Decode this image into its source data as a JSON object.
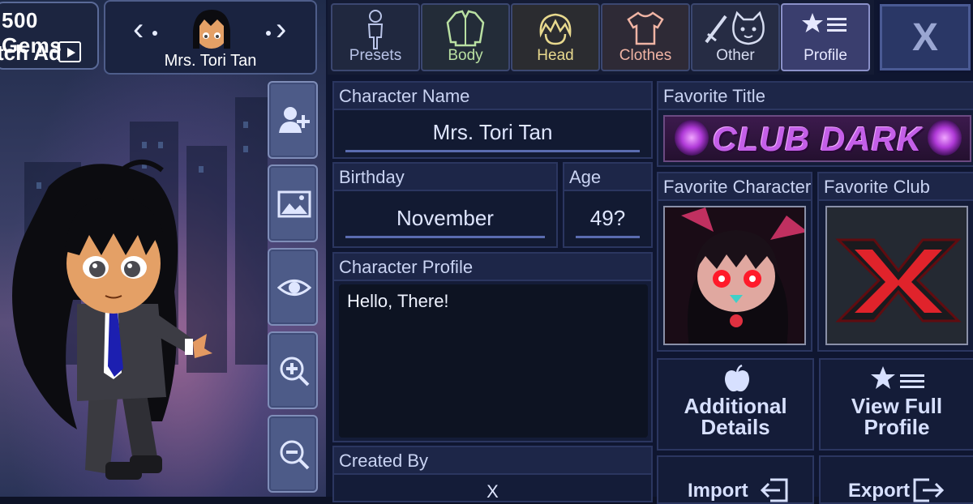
{
  "header": {
    "gems_label": "500 Gems",
    "watch_ad_label": "tch Ad",
    "character_name": "Mrs. Tori Tan"
  },
  "tabs": [
    {
      "label": "Presets",
      "icon": "mannequin-icon",
      "color": "#b9c4e8"
    },
    {
      "label": "Body",
      "icon": "jacket-icon",
      "color": "#b9e0a2"
    },
    {
      "label": "Head",
      "icon": "hair-icon",
      "color": "#e8d98e"
    },
    {
      "label": "Clothes",
      "icon": "shirt-icon",
      "color": "#f0b4a4"
    },
    {
      "label": "Other",
      "icon": "sword-cat-icon",
      "color": "#d6dcf0"
    },
    {
      "label": "Profile",
      "icon": "star-list-icon",
      "color": "#e6e8ff"
    }
  ],
  "close_label": "X",
  "side_tools": [
    "add-user-icon",
    "image-icon",
    "eye-icon",
    "zoom-in-icon",
    "zoom-out-icon"
  ],
  "profile": {
    "name_label": "Character Name",
    "name_value": "Mrs. Tori Tan",
    "birthday_label": "Birthday",
    "birthday_value": "November",
    "age_label": "Age",
    "age_value": "49?",
    "profile_label": "Character Profile",
    "profile_value": "Hello, There!",
    "created_by_label": "Created By",
    "created_by_value": "X"
  },
  "favorites": {
    "title_label": "Favorite Title",
    "title_banner": "CLUB DARK",
    "character_label": "Favorite Character",
    "club_label": "Favorite Club"
  },
  "actions": {
    "additional_line1": "Additional",
    "additional_line2": "Details",
    "view_line1": "View Full",
    "view_line2": "Profile",
    "import_label": "Import",
    "export_label": "Export"
  },
  "colors": {
    "panel_bg": "#0f1630",
    "header_bg": "#1d2648",
    "accent": "#5a6cb0",
    "banner_purple": "#c45fe8",
    "club_red": "#e0232b"
  }
}
